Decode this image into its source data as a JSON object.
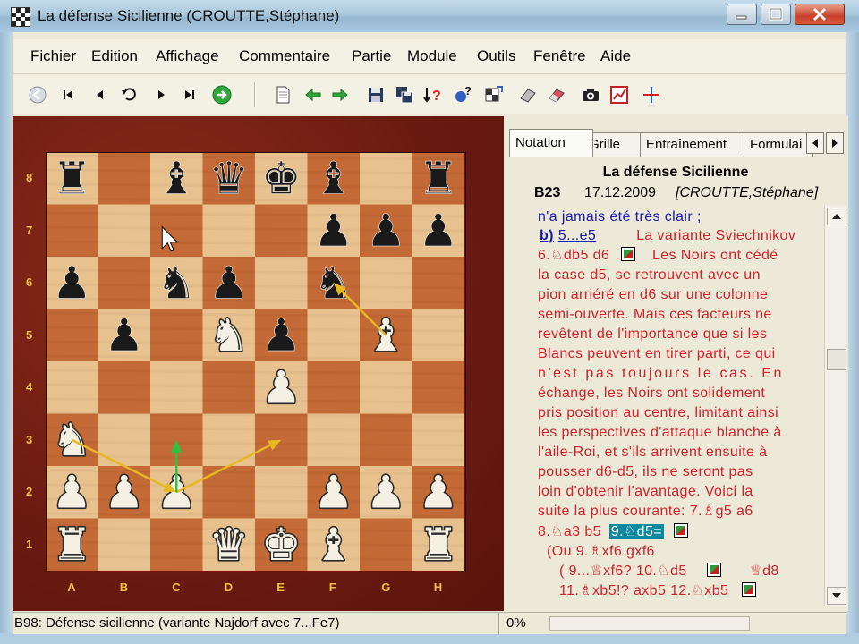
{
  "window": {
    "title": "La défense Sicilienne  (CROUTTE,Stéphane)"
  },
  "menu": [
    "Fichier",
    "Edition",
    "Affichage",
    "Commentaire",
    "Partie",
    "Module",
    "Outils",
    "Fenêtre",
    "Aide"
  ],
  "toolbar_icons": [
    "back-circle-icon",
    "first-move-icon",
    "prev-move-icon",
    "undo-icon",
    "next-move-icon",
    "last-move-icon",
    "play-green-icon",
    "new-document-icon",
    "arrow-left-green-icon",
    "arrow-right-green-icon",
    "save-disk-icon",
    "save-multiple-icon",
    "sort-question-icon",
    "piece-question-icon",
    "board-setup-icon",
    "eraser-icon",
    "eraser-red-icon",
    "camera-icon",
    "chart-red-icon",
    "crosshair-icon"
  ],
  "board": {
    "ranks": [
      "8",
      "7",
      "6",
      "5",
      "4",
      "3",
      "2",
      "1"
    ],
    "files": [
      "A",
      "B",
      "C",
      "D",
      "E",
      "F",
      "G",
      "H"
    ],
    "pieces": [
      {
        "square": "a8",
        "piece": "r"
      },
      {
        "square": "c8",
        "piece": "b"
      },
      {
        "square": "d8",
        "piece": "q"
      },
      {
        "square": "e8",
        "piece": "k"
      },
      {
        "square": "f8",
        "piece": "b"
      },
      {
        "square": "h8",
        "piece": "r"
      },
      {
        "square": "f7",
        "piece": "p"
      },
      {
        "square": "g7",
        "piece": "p"
      },
      {
        "square": "h7",
        "piece": "p"
      },
      {
        "square": "a6",
        "piece": "p"
      },
      {
        "square": "c6",
        "piece": "n"
      },
      {
        "square": "d6",
        "piece": "p"
      },
      {
        "square": "f6",
        "piece": "n"
      },
      {
        "square": "b5",
        "piece": "p"
      },
      {
        "square": "d5",
        "piece": "N"
      },
      {
        "square": "e5",
        "piece": "p"
      },
      {
        "square": "g5",
        "piece": "B"
      },
      {
        "square": "e4",
        "piece": "P"
      },
      {
        "square": "a3",
        "piece": "N"
      },
      {
        "square": "a2",
        "piece": "P"
      },
      {
        "square": "b2",
        "piece": "P"
      },
      {
        "square": "c2",
        "piece": "P"
      },
      {
        "square": "f2",
        "piece": "P"
      },
      {
        "square": "g2",
        "piece": "P"
      },
      {
        "square": "h2",
        "piece": "P"
      },
      {
        "square": "a1",
        "piece": "R"
      },
      {
        "square": "d1",
        "piece": "Q"
      },
      {
        "square": "e1",
        "piece": "K"
      },
      {
        "square": "f1",
        "piece": "B"
      },
      {
        "square": "h1",
        "piece": "R"
      }
    ],
    "arrows": [
      {
        "from": "g5",
        "to": "f6",
        "color": "#e8b820"
      },
      {
        "from": "a3",
        "to": "c2",
        "color": "#e8b820"
      },
      {
        "from": "c2",
        "to": "e3",
        "color": "#e8b820"
      },
      {
        "from": "c2",
        "to": "c3",
        "color": "#30c040"
      }
    ],
    "light_color": "#e8c28e",
    "dark_color": "#c46a36",
    "cursor_square": "c7"
  },
  "panel": {
    "tabs": [
      "Notation",
      "Grille",
      "Entraînement",
      "Formulai"
    ],
    "title": "La défense Sicilienne",
    "game_code": "B23",
    "game_date": "17.12.2009",
    "game_player": "[CROUTTE,Stéphane]",
    "lines": {
      "l0": "n'a jamais été très clair ;",
      "l1a": "b)",
      "l1b": "5...e5",
      "l1c": "La variante Sviechnikov",
      "l2a": "6.♘db5   d6",
      "l2b": "Les Noirs ont cédé",
      "l3": "la case d5, se retrouvent avec un",
      "l4": "pion arriéré en d6 sur une colonne",
      "l5": "semi-ouverte. Mais ces facteurs ne",
      "l6": "revêtent de l'importance que si les",
      "l7": "Blancs peuvent en tirer parti, ce qui",
      "l8": "n'est pas toujours le cas. En",
      "l9": "échange, les Noirs ont solidement",
      "l10": "pris position au centre, limitant ainsi",
      "l11": "les perspectives d'attaque blanche à",
      "l12": "l'aile-Roi, et s'ils arrivent ensuite à",
      "l13": "pousser d6-d5, ils ne seront pas",
      "l14": "loin d'obtenir l'avantage. Voici la",
      "l15": "suite la plus courante: 7.♗g5     a6",
      "l16a": "8.♘a3  b5",
      "l16b": "9.♘d5=",
      "l17": "(Ou  9.♗xf6  gxf6",
      "l18a": "( 9...♕xf6?     10.♘d5",
      "l18b": "♕d8",
      "l19a": "11.♗xb5!?      axb5     12.♘xb5"
    }
  },
  "status": {
    "text": "B98: Défense sicilienne (variante Najdorf avec 7...Fe7)",
    "progress": "0%"
  }
}
